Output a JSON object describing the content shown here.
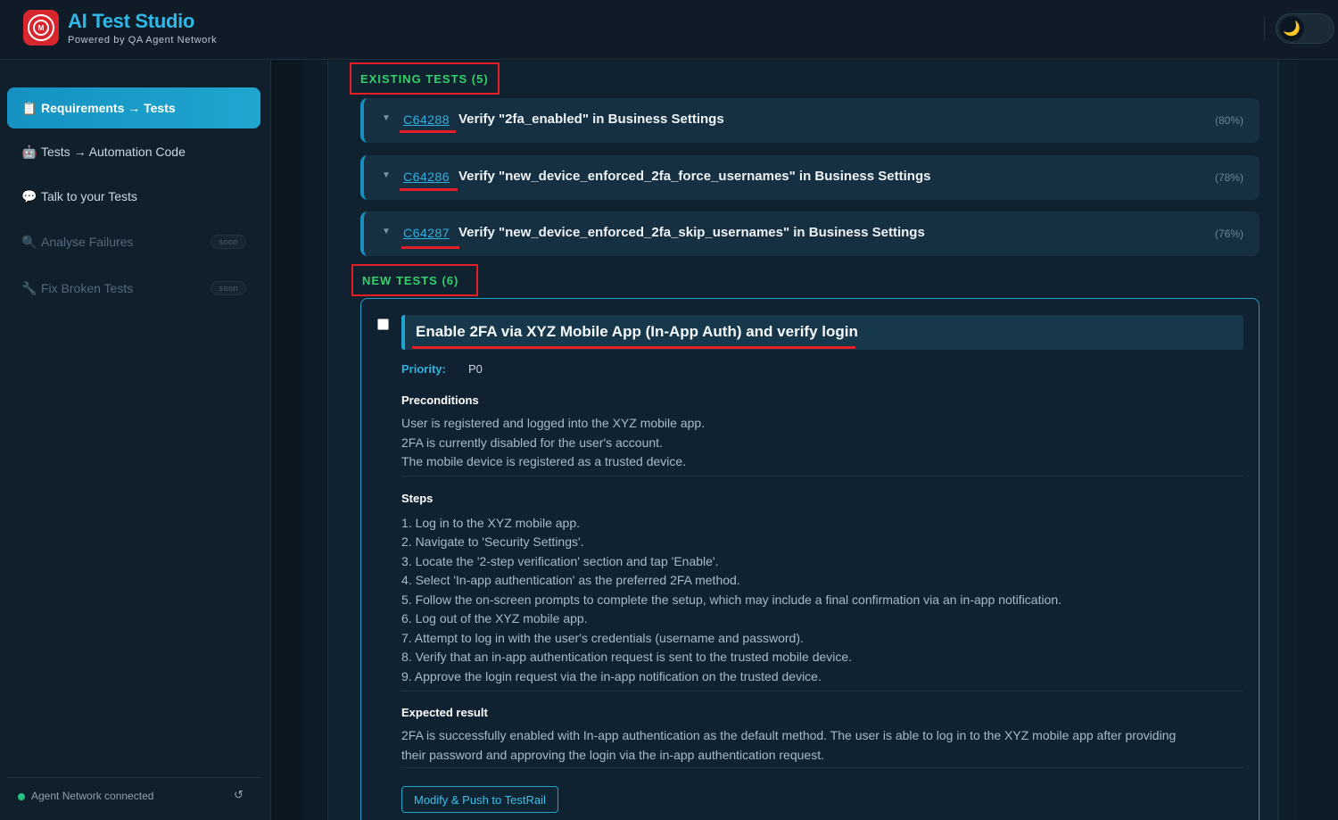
{
  "header": {
    "title": "AI Test Studio",
    "subtitle": "Powered by QA Agent Network",
    "theme_icon": "🌙"
  },
  "sidebar": {
    "items": [
      {
        "icon": "📋",
        "label": "Requirements → Tests",
        "active": true
      },
      {
        "icon": "🤖",
        "label": "Tests → Automation Code"
      },
      {
        "icon": "💬",
        "label": "Talk to your Tests"
      },
      {
        "icon": "🔍",
        "label": "Analyse Failures",
        "badge": "soon"
      },
      {
        "icon": "🔧",
        "label": "Fix Broken Tests",
        "badge": "soon"
      }
    ],
    "status": "Agent Network connected",
    "refresh_icon": "↺"
  },
  "existing": {
    "label": "EXISTING TESTS (5)",
    "tests": [
      {
        "id": "C64288",
        "title": "Verify \"2fa_enabled\" in Business Settings",
        "match": "(80%)"
      },
      {
        "id": "C64286",
        "title": "Verify \"new_device_enforced_2fa_force_usernames\" in Business Settings",
        "match": "(78%)"
      },
      {
        "id": "C64287",
        "title": "Verify \"new_device_enforced_2fa_skip_usernames\" in Business Settings",
        "match": "(76%)"
      }
    ]
  },
  "new_tests": {
    "label": "NEW TESTS (6)",
    "card": {
      "title": "Enable 2FA via XYZ Mobile App (In-App Auth) and verify login",
      "priority_label": "Priority:",
      "priority_value": "P0",
      "preconditions_heading": "Preconditions",
      "preconditions": [
        "User is registered and logged into the XYZ mobile app.",
        "2FA is currently disabled for the user's account.",
        "The mobile device is registered as a trusted device."
      ],
      "steps_heading": "Steps",
      "steps": [
        "1. Log in to the XYZ mobile app.",
        "2. Navigate to 'Security Settings'.",
        "3. Locate the '2-step verification' section and tap 'Enable'.",
        "4. Select 'In-app authentication' as the preferred 2FA method.",
        "5. Follow the on-screen prompts to complete the setup, which may include a final confirmation via an in-app notification.",
        "6. Log out of the XYZ mobile app.",
        "7. Attempt to log in with the user's credentials (username and password).",
        "8. Verify that an in-app authentication request is sent to the trusted mobile device.",
        "9. Approve the login request via the in-app notification on the trusted device."
      ],
      "expected_heading": "Expected result",
      "expected": [
        "2FA is successfully enabled with In-app authentication as the default method. The user is able to log in to the XYZ mobile app after providing",
        "their password and approving the login via the in-app authentication request."
      ],
      "push_button": "Modify & Push to TestRail"
    }
  },
  "colors": {
    "accent": "#1fa6cf",
    "section_label": "#33d06a",
    "highlight_red": "#e31e24"
  }
}
